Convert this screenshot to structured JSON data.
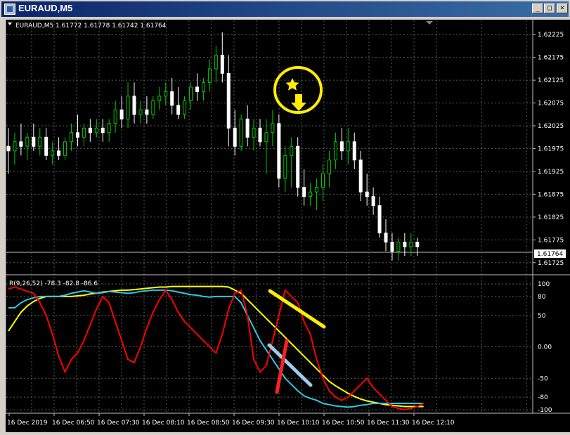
{
  "window": {
    "title": "EURAUD,M5",
    "minimize": "_",
    "restore": "□",
    "close": "×"
  },
  "main": {
    "header": "EURAUD,M5  1.61772 1.61778 1.61742 1.61764",
    "price_labels": [
      "1.62225",
      "1.62175",
      "1.62125",
      "1.62075",
      "1.62025",
      "1.61975",
      "1.61925",
      "1.61875",
      "1.61825",
      "1.61775",
      "1.61725"
    ],
    "current_price": "1.61764"
  },
  "indicator": {
    "header": "R(9,26,52) -78.3 -82.8 -86.6",
    "scale_labels": [
      "100",
      "80",
      "50",
      "0.00",
      "-50",
      "-80",
      "-100"
    ]
  },
  "time_labels": [
    "16 Dec 2019",
    "16 Dec 06:50",
    "16 Dec 07:30",
    "16 Dec 08:10",
    "16 Dec 08:50",
    "16 Dec 09:30",
    "16 Dec 10:10",
    "16 Dec 10:50",
    "16 Dec 11:30",
    "16 Dec 12:10"
  ],
  "colors": {
    "bull": "#00c800",
    "bear": "#ffffff",
    "grid": "#5a5a5a",
    "red": "#ff0000",
    "cyan": "#30c8e0",
    "yellow": "#ffff00",
    "annotation": "#ffee00",
    "arrow_light": "#9acde8"
  },
  "chart_data": {
    "type": "candlestick",
    "ylim": [
      1.617,
      1.6225
    ],
    "candles": [
      {
        "o": 1.6198,
        "h": 1.6202,
        "l": 1.6192,
        "c": 1.6197
      },
      {
        "o": 1.6197,
        "h": 1.6201,
        "l": 1.6194,
        "c": 1.6199
      },
      {
        "o": 1.6199,
        "h": 1.6203,
        "l": 1.6196,
        "c": 1.6198
      },
      {
        "o": 1.6198,
        "h": 1.6201,
        "l": 1.6195,
        "c": 1.62
      },
      {
        "o": 1.62,
        "h": 1.6203,
        "l": 1.6197,
        "c": 1.6198
      },
      {
        "o": 1.6198,
        "h": 1.6202,
        "l": 1.6196,
        "c": 1.62
      },
      {
        "o": 1.62,
        "h": 1.6202,
        "l": 1.6195,
        "c": 1.6196
      },
      {
        "o": 1.6196,
        "h": 1.6199,
        "l": 1.6194,
        "c": 1.6197
      },
      {
        "o": 1.6197,
        "h": 1.62,
        "l": 1.6195,
        "c": 1.6196
      },
      {
        "o": 1.6196,
        "h": 1.62,
        "l": 1.6195,
        "c": 1.6199
      },
      {
        "o": 1.6199,
        "h": 1.6203,
        "l": 1.6197,
        "c": 1.6201
      },
      {
        "o": 1.6201,
        "h": 1.6205,
        "l": 1.6198,
        "c": 1.62
      },
      {
        "o": 1.62,
        "h": 1.6203,
        "l": 1.6198,
        "c": 1.6202
      },
      {
        "o": 1.6202,
        "h": 1.6204,
        "l": 1.6199,
        "c": 1.6201
      },
      {
        "o": 1.6201,
        "h": 1.6204,
        "l": 1.62,
        "c": 1.6202
      },
      {
        "o": 1.6202,
        "h": 1.6204,
        "l": 1.6199,
        "c": 1.6201
      },
      {
        "o": 1.6201,
        "h": 1.6204,
        "l": 1.6199,
        "c": 1.6203
      },
      {
        "o": 1.6203,
        "h": 1.6208,
        "l": 1.6201,
        "c": 1.6206
      },
      {
        "o": 1.6206,
        "h": 1.6209,
        "l": 1.6202,
        "c": 1.6204
      },
      {
        "o": 1.6204,
        "h": 1.6212,
        "l": 1.6202,
        "c": 1.6209
      },
      {
        "o": 1.6209,
        "h": 1.6212,
        "l": 1.6203,
        "c": 1.6205
      },
      {
        "o": 1.6205,
        "h": 1.6208,
        "l": 1.6203,
        "c": 1.6206
      },
      {
        "o": 1.6206,
        "h": 1.6209,
        "l": 1.6203,
        "c": 1.6205
      },
      {
        "o": 1.6205,
        "h": 1.6209,
        "l": 1.6204,
        "c": 1.6208
      },
      {
        "o": 1.6208,
        "h": 1.6211,
        "l": 1.6206,
        "c": 1.6209
      },
      {
        "o": 1.6209,
        "h": 1.6212,
        "l": 1.6207,
        "c": 1.621
      },
      {
        "o": 1.621,
        "h": 1.6213,
        "l": 1.6205,
        "c": 1.6207
      },
      {
        "o": 1.6207,
        "h": 1.6211,
        "l": 1.6204,
        "c": 1.6205
      },
      {
        "o": 1.6205,
        "h": 1.6209,
        "l": 1.6204,
        "c": 1.6208
      },
      {
        "o": 1.6208,
        "h": 1.6212,
        "l": 1.6206,
        "c": 1.6211
      },
      {
        "o": 1.6211,
        "h": 1.6214,
        "l": 1.6208,
        "c": 1.621
      },
      {
        "o": 1.621,
        "h": 1.6213,
        "l": 1.6208,
        "c": 1.6212
      },
      {
        "o": 1.6212,
        "h": 1.6217,
        "l": 1.621,
        "c": 1.6215
      },
      {
        "o": 1.6215,
        "h": 1.622,
        "l": 1.6212,
        "c": 1.6218
      },
      {
        "o": 1.6218,
        "h": 1.6223,
        "l": 1.6212,
        "c": 1.6214
      },
      {
        "o": 1.6214,
        "h": 1.6218,
        "l": 1.6198,
        "c": 1.6202
      },
      {
        "o": 1.6202,
        "h": 1.6206,
        "l": 1.6196,
        "c": 1.6198
      },
      {
        "o": 1.6198,
        "h": 1.6205,
        "l": 1.6197,
        "c": 1.6204
      },
      {
        "o": 1.6204,
        "h": 1.6207,
        "l": 1.6198,
        "c": 1.62
      },
      {
        "o": 1.62,
        "h": 1.6204,
        "l": 1.6197,
        "c": 1.6202
      },
      {
        "o": 1.6202,
        "h": 1.6204,
        "l": 1.6198,
        "c": 1.6199
      },
      {
        "o": 1.6199,
        "h": 1.6204,
        "l": 1.6192,
        "c": 1.6201
      },
      {
        "o": 1.6201,
        "h": 1.6206,
        "l": 1.6198,
        "c": 1.6203
      },
      {
        "o": 1.6203,
        "h": 1.6205,
        "l": 1.6189,
        "c": 1.6191
      },
      {
        "o": 1.6191,
        "h": 1.6198,
        "l": 1.6188,
        "c": 1.6196
      },
      {
        "o": 1.6196,
        "h": 1.62,
        "l": 1.6189,
        "c": 1.6198
      },
      {
        "o": 1.6198,
        "h": 1.62,
        "l": 1.6187,
        "c": 1.6189
      },
      {
        "o": 1.6189,
        "h": 1.6193,
        "l": 1.6185,
        "c": 1.6187
      },
      {
        "o": 1.6187,
        "h": 1.619,
        "l": 1.6185,
        "c": 1.6188
      },
      {
        "o": 1.6188,
        "h": 1.6191,
        "l": 1.6184,
        "c": 1.6189
      },
      {
        "o": 1.6189,
        "h": 1.6194,
        "l": 1.6186,
        "c": 1.6192
      },
      {
        "o": 1.6192,
        "h": 1.6197,
        "l": 1.6189,
        "c": 1.6195
      },
      {
        "o": 1.6195,
        "h": 1.6201,
        "l": 1.6193,
        "c": 1.6199
      },
      {
        "o": 1.6199,
        "h": 1.6202,
        "l": 1.6195,
        "c": 1.6197
      },
      {
        "o": 1.6197,
        "h": 1.6202,
        "l": 1.6194,
        "c": 1.6199
      },
      {
        "o": 1.6199,
        "h": 1.6201,
        "l": 1.6193,
        "c": 1.6195
      },
      {
        "o": 1.6195,
        "h": 1.6197,
        "l": 1.6186,
        "c": 1.6188
      },
      {
        "o": 1.6188,
        "h": 1.6192,
        "l": 1.6185,
        "c": 1.6187
      },
      {
        "o": 1.6187,
        "h": 1.6189,
        "l": 1.6183,
        "c": 1.6185
      },
      {
        "o": 1.6185,
        "h": 1.6187,
        "l": 1.6178,
        "c": 1.6179
      },
      {
        "o": 1.6179,
        "h": 1.6182,
        "l": 1.6175,
        "c": 1.6177
      },
      {
        "o": 1.6177,
        "h": 1.6179,
        "l": 1.6173,
        "c": 1.6175
      },
      {
        "o": 1.6175,
        "h": 1.6178,
        "l": 1.6173,
        "c": 1.6177
      },
      {
        "o": 1.6177,
        "h": 1.6179,
        "l": 1.6174,
        "c": 1.6176
      },
      {
        "o": 1.6176,
        "h": 1.6179,
        "l": 1.6174,
        "c": 1.6177
      },
      {
        "o": 1.6177,
        "h": 1.6178,
        "l": 1.6174,
        "c": 1.6176
      }
    ],
    "indicator": {
      "range": [
        -100,
        100
      ],
      "red": [
        92,
        95,
        92,
        88,
        85,
        70,
        50,
        20,
        -15,
        -40,
        -20,
        -10,
        10,
        35,
        60,
        80,
        70,
        40,
        10,
        -20,
        -25,
        0,
        30,
        55,
        75,
        90,
        75,
        55,
        40,
        30,
        20,
        10,
        0,
        -10,
        20,
        60,
        85,
        90,
        50,
        -20,
        -40,
        -30,
        10,
        50,
        90,
        80,
        70,
        40,
        20,
        -20,
        -50,
        -70,
        -80,
        -85,
        -80,
        -70,
        -60,
        -50,
        -65,
        -75,
        -85,
        -95,
        -98,
        -100,
        -98,
        -95,
        -90
      ],
      "cyan": [
        62,
        62,
        70,
        75,
        78,
        80,
        80,
        80,
        80,
        82,
        85,
        87,
        89,
        87,
        85,
        86,
        88,
        87,
        86,
        85,
        86,
        88,
        89,
        90,
        90,
        90,
        89,
        87,
        85,
        83,
        82,
        80,
        79,
        80,
        80,
        80,
        80,
        70,
        50,
        30,
        10,
        -5,
        -20,
        -35,
        -50,
        -60,
        -70,
        -78,
        -82,
        -85,
        -90,
        -92,
        -94,
        -95,
        -96,
        -95,
        -93,
        -92,
        -90,
        -90,
        -90,
        -90,
        -90,
        -90,
        -90,
        -90,
        -90
      ],
      "yellow": [
        25,
        40,
        55,
        65,
        72,
        77,
        80,
        80,
        80,
        80,
        80,
        81,
        82,
        84,
        85,
        87,
        88,
        89,
        90,
        90,
        91,
        92,
        93,
        94,
        95,
        95,
        96,
        96,
        96,
        96,
        96,
        96,
        96,
        96,
        96,
        95,
        90,
        85,
        75,
        65,
        55,
        45,
        35,
        25,
        15,
        5,
        -5,
        -15,
        -25,
        -35,
        -45,
        -55,
        -62,
        -68,
        -74,
        -79,
        -83,
        -86,
        -88,
        -90,
        -92,
        -93,
        -94,
        -95,
        -95,
        -95,
        -95
      ]
    }
  }
}
